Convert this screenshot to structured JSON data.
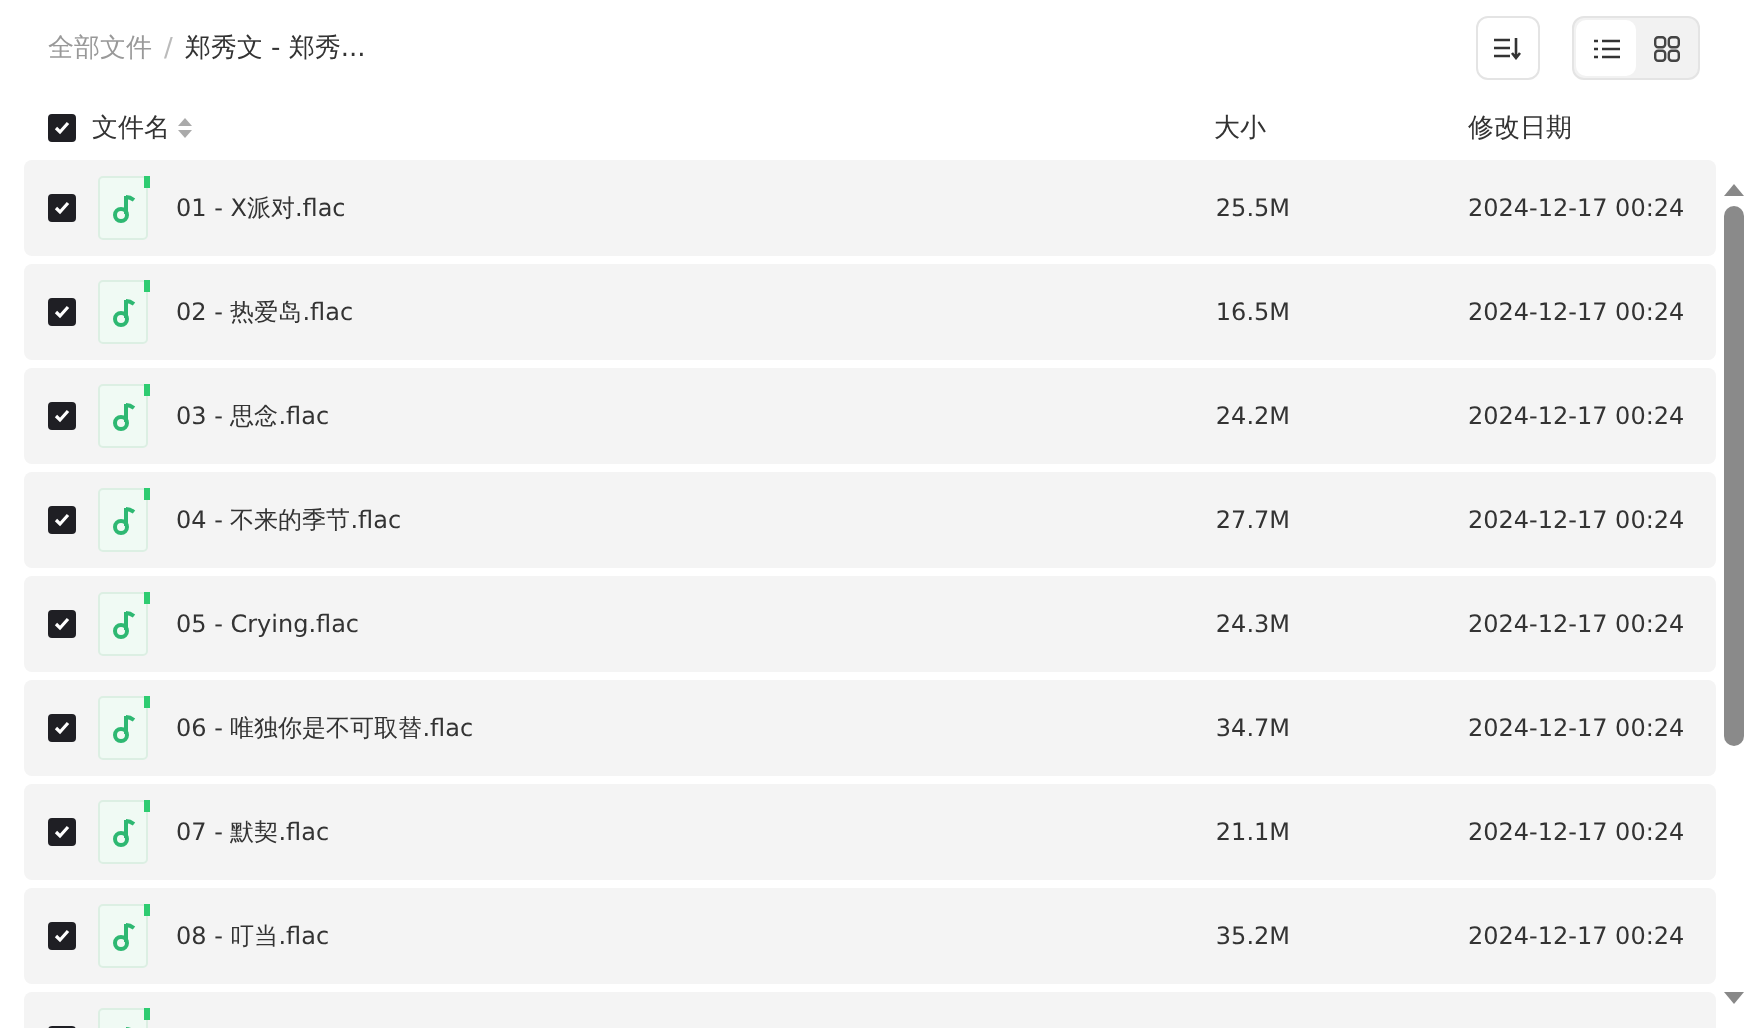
{
  "breadcrumb_separator": "/",
  "breadcrumb": [
    {
      "label": "全部文件",
      "current": false
    },
    {
      "label": "郑秀文 - 郑秀...",
      "current": true
    }
  ],
  "view_toggle": [
    {
      "kind": "list",
      "selected": true
    },
    {
      "kind": "grid",
      "selected": false
    }
  ],
  "header": {
    "checked": true,
    "columns": [
      "文件名",
      "大小",
      "修改日期"
    ]
  },
  "rows": [
    {
      "checked": true,
      "name": "01 - X派对.flac",
      "size": "25.5M",
      "modified": "2024-12-17 00:24"
    },
    {
      "checked": true,
      "name": "02 - 热爱岛.flac",
      "size": "16.5M",
      "modified": "2024-12-17 00:24"
    },
    {
      "checked": true,
      "name": "03 - 思念.flac",
      "size": "24.2M",
      "modified": "2024-12-17 00:24"
    },
    {
      "checked": true,
      "name": "04 - 不来的季节.flac",
      "size": "27.7M",
      "modified": "2024-12-17 00:24"
    },
    {
      "checked": true,
      "name": "05 - Crying.flac",
      "size": "24.3M",
      "modified": "2024-12-17 00:24"
    },
    {
      "checked": true,
      "name": "06 - 唯独你是不可取替.flac",
      "size": "34.7M",
      "modified": "2024-12-17 00:24"
    },
    {
      "checked": true,
      "name": "07 - 默契.flac",
      "size": "21.1M",
      "modified": "2024-12-17 00:24"
    },
    {
      "checked": true,
      "name": "08 - 叮当.flac",
      "size": "35.2M",
      "modified": "2024-12-17 00:24"
    },
    {
      "checked": true
    }
  ]
}
